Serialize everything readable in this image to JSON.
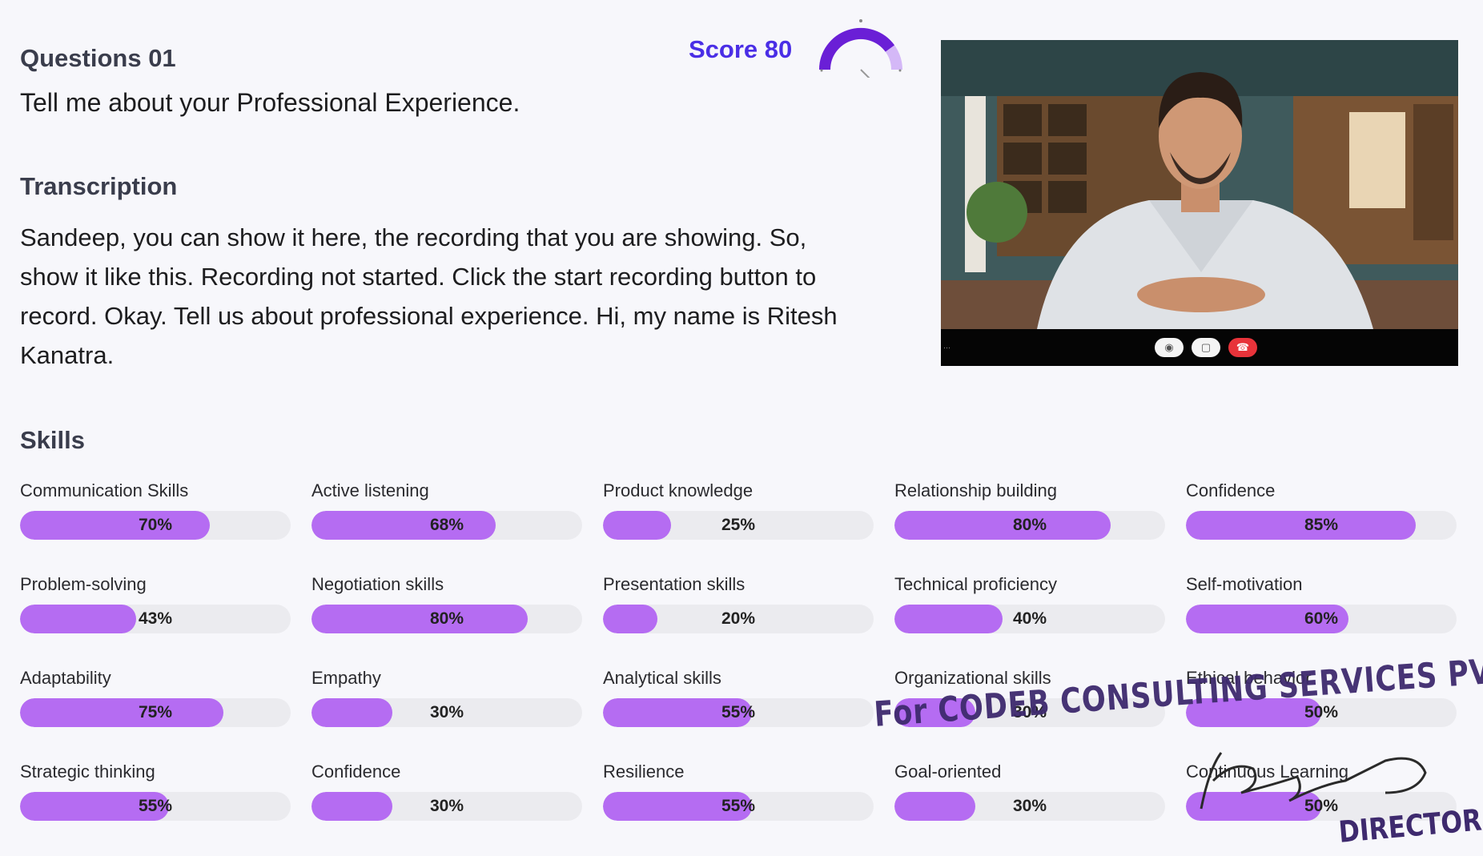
{
  "question": {
    "label": "Questions 01",
    "text": "Tell me about  your Professional Experience."
  },
  "transcription": {
    "label": "Transcription",
    "text": "Sandeep, you can show it here, the recording that you are showing. So, show it like this. Recording not started. Click the start recording button to record. Okay. Tell us about professional experience. Hi, my name is Ritesh Kanatra."
  },
  "score": {
    "label": "Score 80",
    "value": 80
  },
  "video": {
    "controls": [
      {
        "icon": "mic-icon"
      },
      {
        "icon": "camera-icon"
      },
      {
        "icon": "end-call-icon"
      }
    ]
  },
  "skills": {
    "label": "Skills",
    "items": [
      {
        "name": "Communication Skills",
        "value": "70%",
        "pct": 70
      },
      {
        "name": "Active listening",
        "value": "68%",
        "pct": 68
      },
      {
        "name": "Product knowledge",
        "value": "25%",
        "pct": 25
      },
      {
        "name": "Relationship building",
        "value": "80%",
        "pct": 80
      },
      {
        "name": "Confidence",
        "value": "85%",
        "pct": 85
      },
      {
        "name": "Problem-solving",
        "value": "43%",
        "pct": 43
      },
      {
        "name": "Negotiation skills",
        "value": "80%",
        "pct": 80
      },
      {
        "name": "Presentation skills",
        "value": "20%",
        "pct": 20
      },
      {
        "name": "Technical proficiency",
        "value": "40%",
        "pct": 40
      },
      {
        "name": "Self-motivation",
        "value": "60%",
        "pct": 60
      },
      {
        "name": "Adaptability",
        "value": "75%",
        "pct": 75
      },
      {
        "name": "Empathy",
        "value": "30%",
        "pct": 30
      },
      {
        "name": "Analytical skills",
        "value": "55%",
        "pct": 55
      },
      {
        "name": "Organizational skills",
        "value": "30%",
        "pct": 30
      },
      {
        "name": "Ethical behavior",
        "value": "50%",
        "pct": 50
      },
      {
        "name": "Strategic thinking",
        "value": "55%",
        "pct": 55
      },
      {
        "name": "Confidence",
        "value": "30%",
        "pct": 30
      },
      {
        "name": "Resilience",
        "value": "55%",
        "pct": 55
      },
      {
        "name": "Goal-oriented",
        "value": "30%",
        "pct": 30
      },
      {
        "name": "Continuous Learning",
        "value": "50%",
        "pct": 50
      }
    ]
  },
  "stamp": {
    "company": "For CODEB CONSULTING SERVICES PVT LTD.",
    "title": "DIRECTOR"
  },
  "colors": {
    "accent": "#b56cf2",
    "score": "#4a2ee6",
    "stamp": "#3e2a6e"
  }
}
